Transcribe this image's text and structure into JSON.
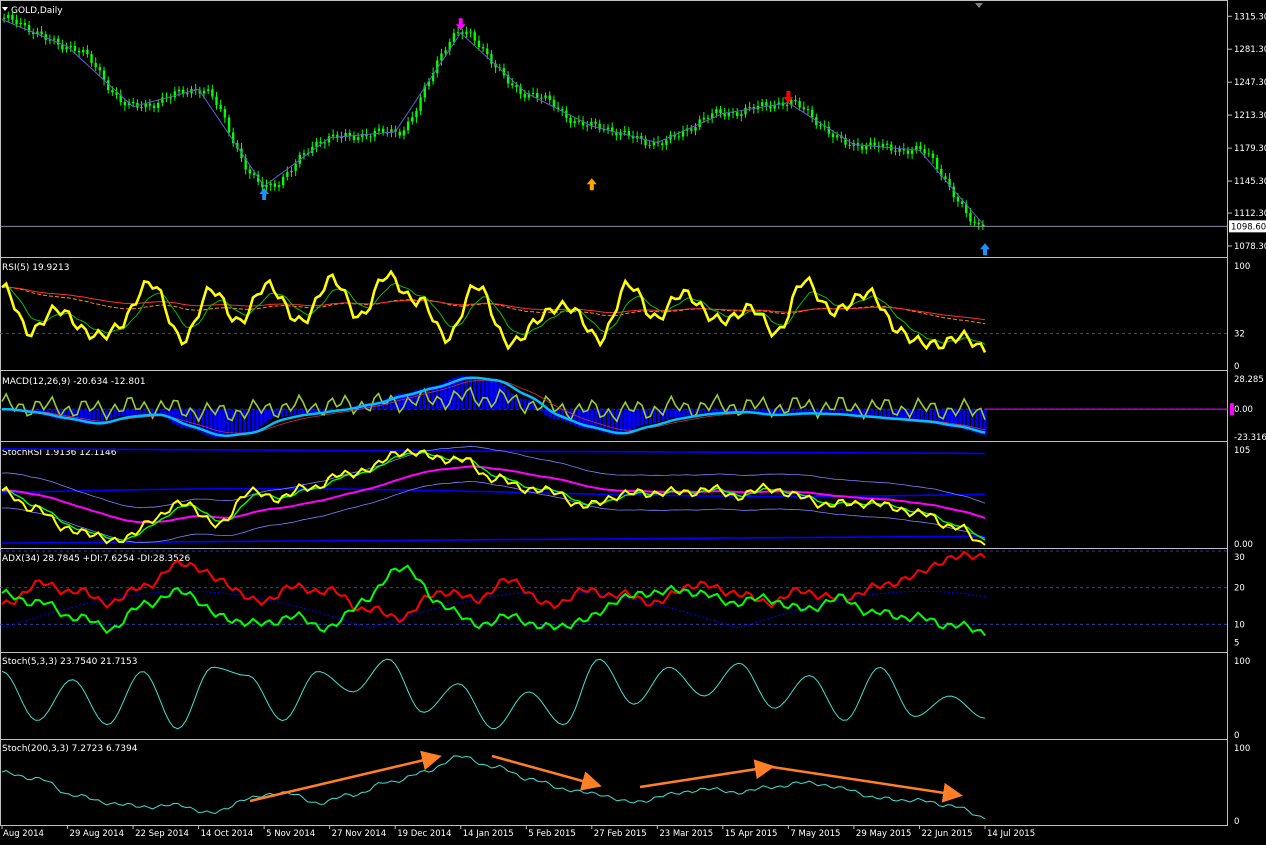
{
  "window": {
    "symbol_title": "GOLD,Daily"
  },
  "colors": {
    "background": "#000000",
    "frame": "#c0c0c0",
    "price_bar": "#00ff00",
    "zigzag": "#6a5acd",
    "rsi_main": "#ffff00",
    "rsi_fast": "#00c000",
    "rsi_slow": "#ff3030",
    "macd_hist": "#0000ff",
    "macd_line": "#9acd32",
    "macd_signal": "#00bfff",
    "stochrsi_k": "#ffff00",
    "stochrsi_d": "#00ff00",
    "stochrsi_ma": "#ff00ff",
    "band": "#0000ff",
    "adx": "#0000ff",
    "plus_di": "#00ff00",
    "minus_di": "#ff0000",
    "stoch": "#40e0d0",
    "arrow_annotation": "#ff7f27"
  },
  "chart_data": [
    {
      "type": "candlestick",
      "title": "GOLD,Daily",
      "ylim": [
        1068,
        1330
      ],
      "y_ticks": [
        "1315.30",
        "1281.30",
        "1247.30",
        "1213.30",
        "1179.30",
        "1145.30",
        "1112.30",
        "1078.30"
      ],
      "current_price": "1098.60",
      "x_ticks": [
        "Aug 2014",
        "29 Aug 2014",
        "22 Sep 2014",
        "14 Oct 2014",
        "5 Nov 2014",
        "27 Nov 2014",
        "19 Dec 2014",
        "14 Jan 2015",
        "5 Feb 2015",
        "27 Feb 2015",
        "23 Mar 2015",
        "15 Apr 2015",
        "7 May 2015",
        "29 May 2015",
        "22 Jun 2015",
        "14 Jul 2015"
      ],
      "series": [
        {
          "name": "GOLD",
          "x": [
            "Aug 2014",
            "29 Aug 2014",
            "22 Sep 2014",
            "14 Oct 2014",
            "5 Nov 2014",
            "27 Nov 2014",
            "19 Dec 2014",
            "14 Jan 2015",
            "5 Feb 2015",
            "27 Feb 2015",
            "23 Mar 2015",
            "15 Apr 2015",
            "7 May 2015",
            "29 May 2015",
            "22 Jun 2015",
            "14 Jul 2015"
          ],
          "close": [
            1312,
            1284,
            1222,
            1240,
            1140,
            1190,
            1196,
            1298,
            1236,
            1202,
            1185,
            1215,
            1226,
            1183,
            1177,
            1098.6
          ]
        }
      ],
      "markers": [
        {
          "kind": "up-arrow",
          "label_date": "5 Nov 2014",
          "price": 1132,
          "color": "#1e90ff"
        },
        {
          "kind": "down-arrow",
          "label_date": "14 Jan 2015",
          "price": 1307,
          "color": "#ff00ff"
        },
        {
          "kind": "up-arrow",
          "label_date": "27 Feb 2015",
          "price": 1142,
          "color": "#ffa500"
        },
        {
          "kind": "down-arrow",
          "label_date": "7 May 2015",
          "price": 1232,
          "color": "#ff0000"
        },
        {
          "kind": "up-arrow",
          "label_date": "14 Jul 2015",
          "price": 1075,
          "color": "#1e90ff"
        }
      ]
    },
    {
      "type": "line",
      "title": "RSI(5) 19.9213",
      "ylim": [
        0,
        100
      ],
      "y_ticks": [
        "100",
        "32",
        "0"
      ],
      "levels": [
        32
      ],
      "series": [
        {
          "name": "RSI(5)",
          "values": [
            72,
            35,
            55,
            28,
            40,
            82,
            25,
            70,
            45,
            78,
            40,
            82,
            50,
            85,
            60,
            30,
            78,
            20,
            45,
            60,
            25,
            75,
            48,
            70,
            42,
            55,
            35,
            80,
            50,
            72,
            38,
            20,
            28,
            20
          ]
        }
      ]
    },
    {
      "type": "bar+line",
      "title": "MACD(12,26,9) -20.634 -12.801",
      "ylim": [
        -23.316,
        28.285
      ],
      "y_ticks": [
        "28.285",
        "0.00",
        "-23.316"
      ],
      "levels": [
        0
      ],
      "series": [
        {
          "name": "MACD",
          "values": [
            0,
            -3,
            -8,
            -12,
            -5,
            -4,
            -15,
            -22,
            -18,
            -6,
            -3,
            0,
            5,
            12,
            18,
            26,
            22,
            8,
            -8,
            -15,
            -20,
            -12,
            -6,
            -3,
            -2,
            -5,
            -3,
            -4,
            -6,
            -8,
            -10,
            -14,
            -20
          ]
        }
      ]
    },
    {
      "type": "line",
      "title": "StochRSI 1.9136 12.1146",
      "ylim": [
        0,
        105
      ],
      "y_ticks": [
        "105",
        "0.00"
      ],
      "series": [
        {
          "name": "StochRSI",
          "values": [
            55,
            40,
            20,
            10,
            6,
            30,
            45,
            20,
            55,
            50,
            60,
            72,
            80,
            98,
            92,
            88,
            70,
            60,
            55,
            40,
            52,
            55,
            55,
            58,
            52,
            60,
            50,
            42,
            45,
            40,
            32,
            20,
            2
          ]
        }
      ]
    },
    {
      "type": "line",
      "title": "ADX(34) 28.7845 +DI:7.6254 -DI:28.3526",
      "ylim": [
        3,
        30
      ],
      "y_ticks": [
        "30",
        "20",
        "10",
        "5"
      ],
      "levels": [
        10,
        20,
        30
      ],
      "series": [
        {
          "name": "+DI",
          "values": [
            18,
            16,
            12,
            9,
            16,
            19,
            12,
            10,
            12,
            9,
            17,
            26,
            16,
            10,
            12,
            9,
            11,
            17,
            19,
            19,
            16,
            17,
            14,
            17,
            13,
            12,
            10,
            8
          ]
        },
        {
          "name": "-DI",
          "values": [
            15,
            21,
            19,
            16,
            21,
            27,
            22,
            16,
            20,
            19,
            14,
            12,
            19,
            17,
            22,
            15,
            19,
            18,
            16,
            21,
            19,
            16,
            19,
            17,
            20,
            23,
            28,
            29
          ]
        }
      ]
    },
    {
      "type": "line",
      "title": "Stoch(5,3,3) 23.7540 21.7153",
      "ylim": [
        0,
        100
      ],
      "y_ticks": [
        "100",
        "0"
      ],
      "series": [
        {
          "name": "Stoch(5,3,3)",
          "values": [
            80,
            20,
            70,
            15,
            80,
            10,
            85,
            75,
            20,
            80,
            55,
            95,
            30,
            65,
            10,
            55,
            15,
            95,
            40,
            85,
            50,
            90,
            35,
            75,
            20,
            85,
            25,
            50,
            23
          ]
        }
      ]
    },
    {
      "type": "line",
      "title": "Stoch(200,3,3) 7.2723 6.7394",
      "ylim": [
        0,
        100
      ],
      "y_ticks": [
        "100",
        "0"
      ],
      "series": [
        {
          "name": "Stoch(200,3,3)",
          "values": [
            62,
            55,
            35,
            25,
            20,
            22,
            12,
            30,
            38,
            25,
            35,
            50,
            62,
            82,
            70,
            55,
            42,
            35,
            25,
            35,
            42,
            38,
            45,
            50,
            42,
            30,
            28,
            22,
            7
          ]
        }
      ]
    }
  ],
  "indicators": {
    "rsi_title": "RSI(5) 19.9213",
    "macd_title": "MACD(12,26,9) -20.634 -12.801",
    "stochrsi_title": "StochRSI 1.9136 12.1146",
    "adx_title": "ADX(34) 28.7845 +DI:7.6254 -DI:28.3526",
    "stoch_fast_title": "Stoch(5,3,3) 23.7540 21.7153",
    "stoch_slow_title": "Stoch(200,3,3) 7.2723 6.7394"
  }
}
